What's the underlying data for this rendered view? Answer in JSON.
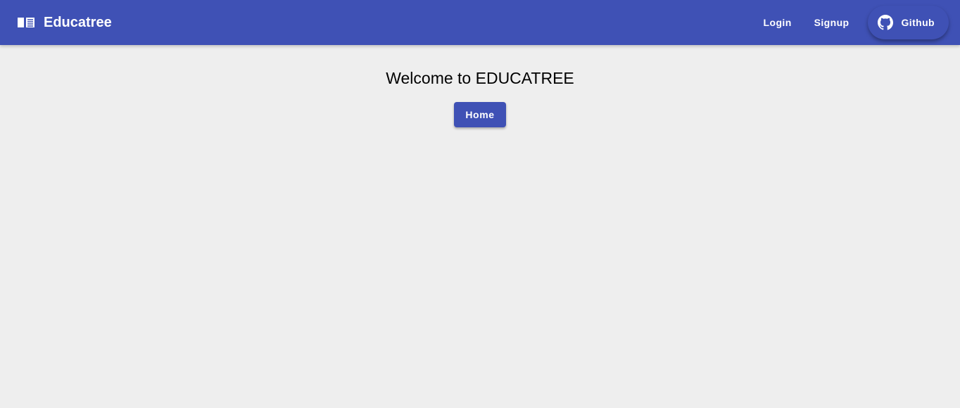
{
  "header": {
    "brand": "Educatree",
    "login": "Login",
    "signup": "Signup",
    "github": "Github"
  },
  "main": {
    "title": "Welcome to EDUCATREE",
    "home_button": "Home"
  },
  "colors": {
    "primary": "#3f51b5",
    "background": "#eeeeee"
  }
}
